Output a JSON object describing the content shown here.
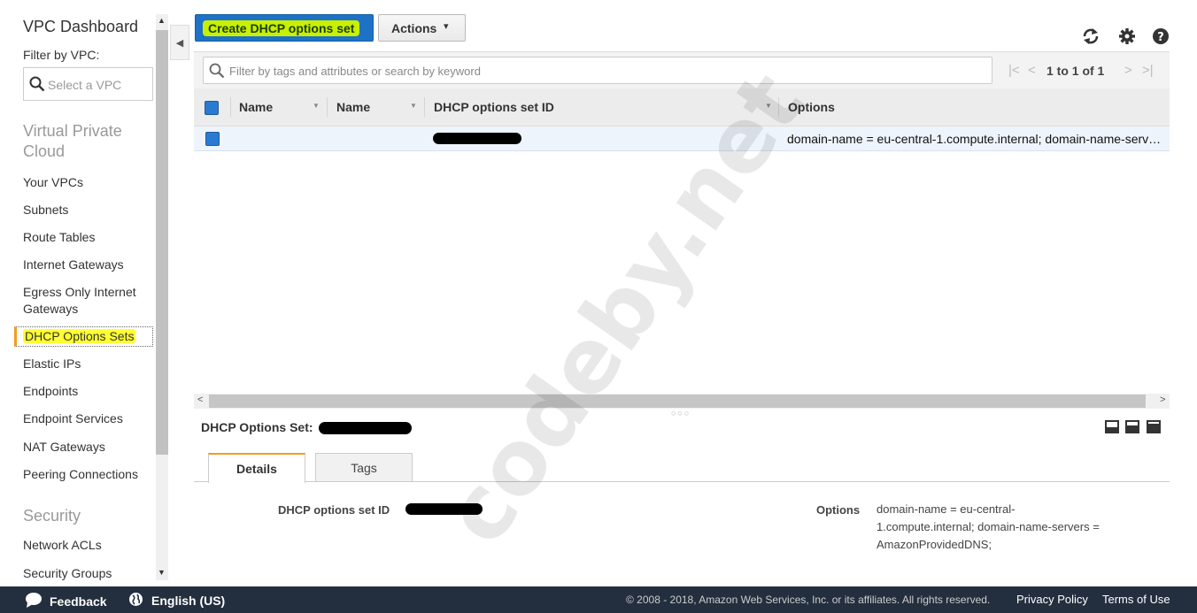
{
  "sidebar": {
    "title": "VPC Dashboard",
    "filter_label": "Filter by VPC:",
    "vpc_placeholder": "Select a VPC",
    "section_vpc": "Virtual Private Cloud",
    "items": [
      "Your VPCs",
      "Subnets",
      "Route Tables",
      "Internet Gateways",
      "Egress Only Internet Gateways",
      "DHCP Options Sets",
      "Elastic IPs",
      "Endpoints",
      "Endpoint Services",
      "NAT Gateways",
      "Peering Connections"
    ],
    "active_item": "DHCP Options Sets",
    "section_security": "Security",
    "security_items": [
      "Network ACLs",
      "Security Groups"
    ]
  },
  "toolbar": {
    "create_label": "Create DHCP options set",
    "actions_label": "Actions",
    "icons": [
      "refresh-icon",
      "gear-icon",
      "help-icon"
    ]
  },
  "filter": {
    "placeholder": "Filter by tags and attributes or search by keyword",
    "pager_text": "1 to 1 of 1"
  },
  "table": {
    "columns": [
      "Name",
      "Name",
      "DHCP options set ID",
      "Options"
    ],
    "rows": [
      {
        "name1": "",
        "name2": "",
        "id": "[redacted]",
        "options": "domain-name = eu-central-1.compute.internal; domain-name-serv…"
      }
    ]
  },
  "detail": {
    "title": "DHCP Options Set:",
    "tabs": [
      "Details",
      "Tags"
    ],
    "id_label": "DHCP options set ID",
    "options_label": "Options",
    "options_value_lines": [
      "domain-name = eu-central-",
      "1.compute.internal; domain-name-servers =",
      "AmazonProvidedDNS;"
    ]
  },
  "watermark": "codeby.net",
  "footer": {
    "feedback": "Feedback",
    "language": "English (US)",
    "copyright": "© 2008 - 2018, Amazon Web Services, Inc. or its affiliates. All rights reserved.",
    "privacy": "Privacy Policy",
    "terms": "Terms of Use"
  },
  "colors": {
    "primary_button": "#1e72c6",
    "highlight": "#ffff32",
    "active_accent": "#f29c22",
    "footer_bg": "#232f3e"
  }
}
